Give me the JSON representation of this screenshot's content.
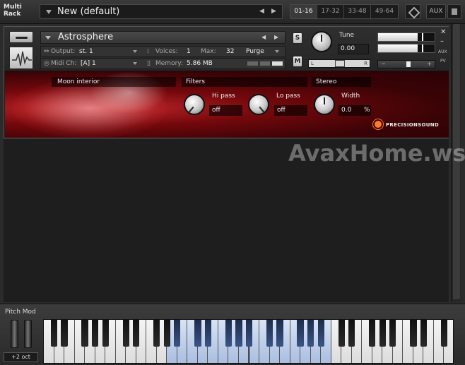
{
  "rack": {
    "label_line1": "Multi",
    "label_line2": "Rack"
  },
  "preset": {
    "name": "New (default)",
    "prev": "◀",
    "next": "▶"
  },
  "page_tabs": [
    "01-16",
    "17-32",
    "33-48",
    "49-64"
  ],
  "active_page_tab": 0,
  "aux_label": "AUX",
  "instrument": {
    "name": "Astrosphere",
    "output_label": "Output:",
    "output_value": "st. 1",
    "voices_label": "Voices:",
    "voices_value": "1",
    "max_label": "Max:",
    "max_value": "32",
    "purge_label": "Purge",
    "midi_label": "Midi Ch:",
    "midi_value": "[A]  1",
    "memory_label": "Memory:",
    "memory_value": "5.86 MB",
    "solo_label": "S",
    "mute_label": "M",
    "tune_label": "Tune",
    "tune_value": "0.00",
    "pan_left": "L",
    "pan_right": "R",
    "aux_tag": "AUX",
    "pv_tag": "PV",
    "meter_left_level": 0.7,
    "meter_right_level": 0.7,
    "volume_level": 0.55
  },
  "gui": {
    "preset_label": "Moon interior",
    "filters_label": "Filters",
    "stereo_label": "Stereo",
    "hipass_label": "Hi pass",
    "hipass_value": "off",
    "lopass_label": "Lo pass",
    "lopass_value": "off",
    "width_label": "Width",
    "width_value": "0.0",
    "width_unit": "%",
    "brand": "PRECISIONSOUND"
  },
  "watermark": "AvaxHome.ws",
  "keyboard": {
    "pitch_mod_label": "Pitch Mod",
    "octave_label": "+2 oct",
    "white_key_count": 40,
    "highlight_white_from": 12,
    "highlight_white_to": 28
  },
  "colors": {
    "accent_red": "#c3272b",
    "brand_orange": "#ff7a22",
    "highlight_blue": "#a9bde0"
  }
}
